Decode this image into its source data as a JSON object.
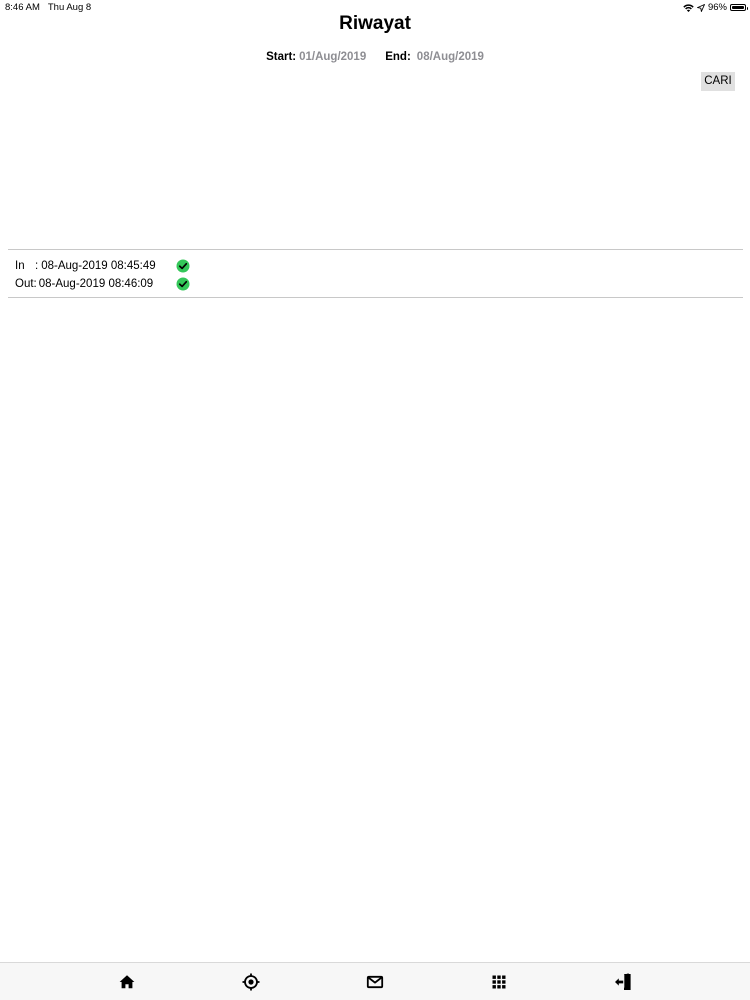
{
  "status_bar": {
    "time": "8:46 AM",
    "date": "Thu Aug 8",
    "battery_percent": "96%",
    "battery_level": 0.96
  },
  "header": {
    "title": "Riwayat"
  },
  "filter": {
    "start_label": "Start:",
    "start_value": "01/Aug/2019",
    "end_label": "End:",
    "end_value": "08/Aug/2019",
    "search_button": "CARI"
  },
  "history": [
    {
      "in_label": "In",
      "in_separator": ":",
      "in_time": "08-Aug-2019 08:45:49",
      "out_label": "Out",
      "out_separator": ":",
      "out_time": "08-Aug-2019 08:46:09"
    }
  ],
  "tab_bar": {
    "items": [
      {
        "icon": "home-icon"
      },
      {
        "icon": "location-target-icon"
      },
      {
        "icon": "mail-icon"
      },
      {
        "icon": "grid-menu-icon"
      },
      {
        "icon": "logout-icon"
      }
    ]
  },
  "colors": {
    "check_green": "#34c759",
    "value_gray": "#8e8e93",
    "button_bg": "#e0e0e0"
  }
}
